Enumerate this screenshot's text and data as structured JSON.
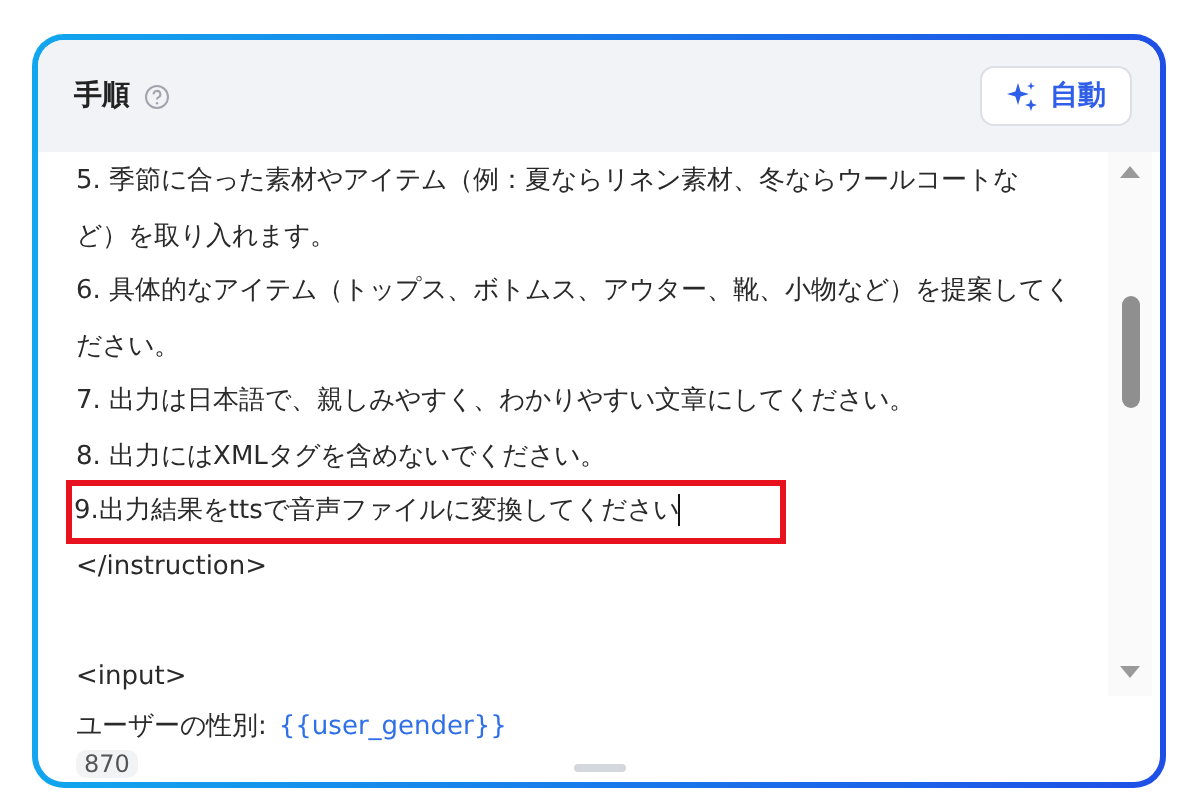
{
  "header": {
    "title": "手順",
    "button": "自動"
  },
  "lines": [
    {
      "kind": "text",
      "text": "5. 季節に合った素材やアイテム（例：夏ならリネン素材、冬ならウールコートな"
    },
    {
      "kind": "text",
      "text": "ど）を取り入れます。"
    },
    {
      "kind": "text",
      "text": "6. 具体的なアイテム（トップス、ボトムス、アウター、靴、小物など）を提案してく"
    },
    {
      "kind": "text",
      "text": "ださい。"
    },
    {
      "kind": "text",
      "text": "7. 出力は日本語で、親しみやすく、わかりやすい文章にしてください。"
    },
    {
      "kind": "text",
      "text": "8. 出力にはXMLタグを含めないでください。"
    },
    {
      "kind": "highlighted",
      "text": "9.出力結果をttsで音声ファイルに変換してください"
    },
    {
      "kind": "text",
      "text": "</instruction>"
    },
    {
      "kind": "blank"
    },
    {
      "kind": "text",
      "text": "<input>"
    },
    {
      "kind": "variable",
      "text": "ユーザーの性別:",
      "variable": "{{user_gender}}"
    }
  ],
  "count": "870"
}
